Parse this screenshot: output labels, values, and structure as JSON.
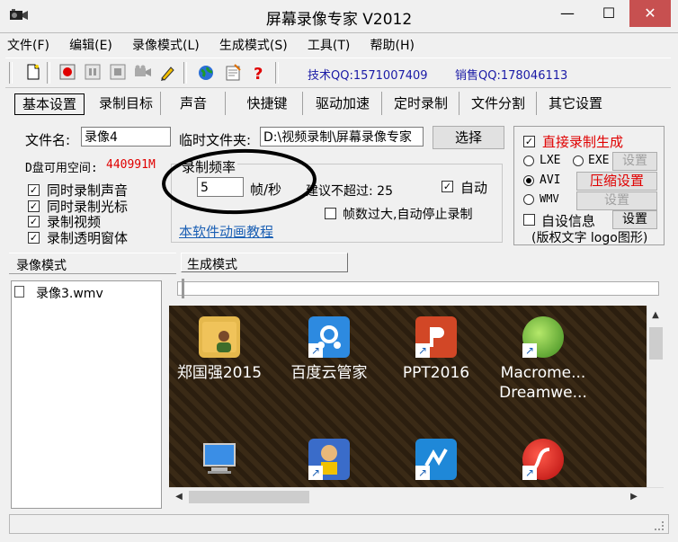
{
  "window": {
    "title": "屏幕录像专家 V2012",
    "minimize": "—",
    "maximize": "☐",
    "close": "✕"
  },
  "menu": [
    "文件(F)",
    "编辑(E)",
    "录像模式(L)",
    "生成模式(S)",
    "工具(T)",
    "帮助(H)"
  ],
  "toolbar": {
    "tech_qq": "技术QQ:1571007409",
    "sales_qq": "销售QQ:178046113"
  },
  "tabs": [
    "基本设置",
    "录制目标",
    "声音",
    "快捷键",
    "驱动加速",
    "定时录制",
    "文件分割",
    "其它设置"
  ],
  "basic": {
    "filename_label": "文件名:",
    "filename_value": "录像4",
    "tempdir_label": "临时文件夹:",
    "tempdir_value": "D:\\视频录制\\屏幕录像专家",
    "browse_button": "选择",
    "disk_label": "D盘可用空间:",
    "disk_value": "440991M",
    "checkboxes": [
      "同时录制声音",
      "同时录制光标",
      "录制视频",
      "录制透明窗体"
    ],
    "frame_group_title": "录制频率",
    "fps_value": "5",
    "fps_unit": "帧/秒",
    "suggest_text": "建议不超过: 25",
    "auto_label": "自动",
    "auto_stop_label": "帧数过大,自动停止录制",
    "tutorial_link": "本软件动画教程"
  },
  "output": {
    "direct_label": "直接录制生成",
    "lxe": "LXE",
    "exe": "EXE",
    "avi": "AVI",
    "wmv": "WMV",
    "settings": "设置",
    "compress_settings": "压缩设置",
    "custom_info": "自设信息",
    "custom_note": "(版权文字 logo图形)"
  },
  "mode_tabs": {
    "record_mode": "录像模式",
    "generate_mode": "生成模式"
  },
  "file_list": [
    "录像3.wmv"
  ],
  "desktop_icons": [
    {
      "label": "郑国强2015",
      "icon": "folder-user-icon"
    },
    {
      "label": "百度云管家",
      "icon": "baidu-cloud-icon"
    },
    {
      "label": "PPT2016",
      "icon": "powerpoint-icon"
    },
    {
      "label": "Macrome...",
      "label2": "Dreamwe...",
      "icon": "dreamweaver-icon"
    },
    {
      "label": "",
      "icon": "computer-icon"
    },
    {
      "label": "",
      "icon": "avatar-shield-icon"
    },
    {
      "label": "",
      "icon": "app-blue-icon"
    },
    {
      "label": "",
      "icon": "flash-icon"
    }
  ],
  "colors": {
    "red_text": "#e00000",
    "blue_link": "#1a5fb4",
    "qq_blue": "#1a1aa6",
    "close_red": "#c75050"
  }
}
